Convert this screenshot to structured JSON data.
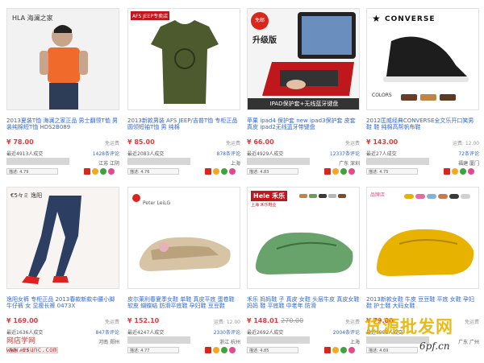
{
  "products": [
    {
      "logo": "HLA 海澜之家",
      "title_prefix": "2013夏装T恤 海澜之家正品 男士翻领T恤 男装纯棉短T恤 HDS2B089",
      "price": "¥ 78.00",
      "shipping": "免运费",
      "sold": "最近4913人成交",
      "reviews": "1428条评论",
      "location": "江苏 江阴",
      "rating": "描述: 4.79"
    },
    {
      "logo": "AFS JEEP专卖店",
      "title_prefix": "2013新款男装 AFS JEEP/吉普T恤 专柜正品 圆领短袖T恤 男 纯棉",
      "price": "¥ 85.00",
      "shipping": "免运费",
      "sold": "最近2083人成交",
      "reviews": "878条评论",
      "location": "上海",
      "rating": "描述: 4.76"
    },
    {
      "badge": "免邮",
      "badge2": "升级版",
      "caption": "IPAD保护套+无线蓝牙键盘",
      "title_prefix": "苹果 ipad4 保护套 new ipad3保护套 皮套 真皮 ipad2无线蓝牙带键盘",
      "price": "¥ 66.00",
      "shipping": "免运费",
      "sold": "最近4929人成交",
      "reviews": "12337条评论",
      "location": "广东 深圳",
      "rating": "描述: 4.83"
    },
    {
      "logo": "CONVERSE",
      "colors_label": "COLORS",
      "title_prefix": "2012匡威经典CONVERSE全文乐开口笑男鞋 鞋 纯棉高帮帆布鞋",
      "price": "¥ 143.00",
      "shipping": "运费: 12.00",
      "sold": "最近27人成交",
      "reviews": "72条评论",
      "location": "福建 厦门",
      "rating": "描述: 4.75"
    },
    {
      "logo": "€5々ミ 逸阳",
      "title_prefix": "逸阳女裤 专柜正品 2013春款新款中腰小脚牛仔裤 女 显瘦长裤 0473X",
      "price": "¥ 169.00",
      "shipping": "免运费",
      "sold": "最近1636人成交",
      "reviews": "847条评论",
      "location": "河南 郑州",
      "rating": "描述: 4.73"
    },
    {
      "logo": "Peter LeiLG",
      "title_prefix": "皮尔莱利春夏季女鞋 单鞋 真皮平底 蛋卷鞋 软皮 蝴蝶结 防滑平底鞋 孕妇鞋 豆豆鞋",
      "price": "¥ 152.10",
      "shipping": "运费: 12.00",
      "sold": "最近4247人成交",
      "reviews": "2330条评论",
      "location": "浙江 杭州",
      "rating": "描述: 4.77"
    },
    {
      "logo": "Hele 禾乐",
      "logo_sub": "上海 禾乐鞋业",
      "title_prefix": "禾乐 妈妈鞋 子 真皮 女鞋 头层牛皮 真皮女鞋 妈妈 鞋 平底鞋 中老年 防滑",
      "price": "¥ 148.01",
      "old_price": "270.00",
      "shipping": "免运费",
      "sold": "最近2692人成交",
      "reviews": "2004条评论",
      "location": "上海",
      "rating": "描述: 4.85"
    },
    {
      "logo": "品牌店",
      "title_prefix": "2013新款女鞋 牛皮 豆豆鞋 平底 女鞋 孕妇鞋 护士鞋 大码女鞋",
      "price": "¥ 79.00",
      "shipping": "免运费",
      "sold": "最近9908人成交",
      "reviews": "",
      "location": "广东 广州",
      "rating": "描述: 4.69"
    }
  ],
  "watermark": {
    "cn": "网店学网",
    "url": "www.esunc.com",
    "right": "货源批发网",
    "right_url": "6pf.cn"
  },
  "colors": {
    "price": "#e4393c",
    "link": "#3366cc",
    "accent": "#f5a623"
  }
}
